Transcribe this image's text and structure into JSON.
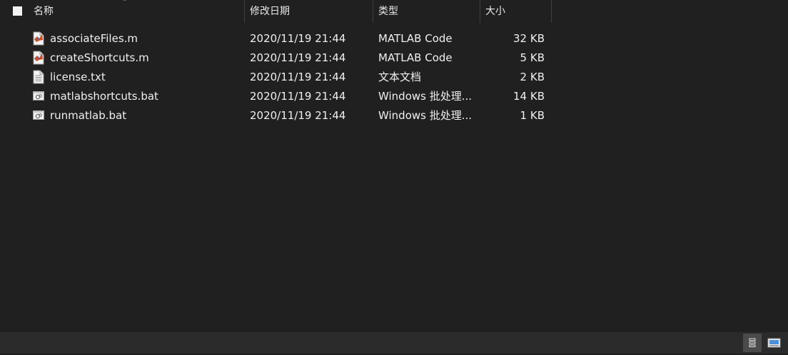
{
  "columns": {
    "name": "名称",
    "date_modified": "修改日期",
    "type": "类型",
    "size": "大小"
  },
  "files": [
    {
      "name": "associateFiles.m",
      "date": "2020/11/19 21:44",
      "type": "MATLAB Code",
      "size": "32 KB",
      "icon": "matlab-file-icon"
    },
    {
      "name": "createShortcuts.m",
      "date": "2020/11/19 21:44",
      "type": "MATLAB Code",
      "size": "5 KB",
      "icon": "matlab-file-icon"
    },
    {
      "name": "license.txt",
      "date": "2020/11/19 21:44",
      "type": "文本文档",
      "size": "2 KB",
      "icon": "text-file-icon"
    },
    {
      "name": "matlabshortcuts.bat",
      "date": "2020/11/19 21:44",
      "type": "Windows 批处理...",
      "size": "14 KB",
      "icon": "batch-file-icon"
    },
    {
      "name": "runmatlab.bat",
      "date": "2020/11/19 21:44",
      "type": "Windows 批处理...",
      "size": "1 KB",
      "icon": "batch-file-icon"
    }
  ],
  "colors": {
    "background": "#202020",
    "status_bar": "#2b2b2b",
    "text": "#f0f0f0",
    "matlab_icon_accent": "#c8502a"
  }
}
